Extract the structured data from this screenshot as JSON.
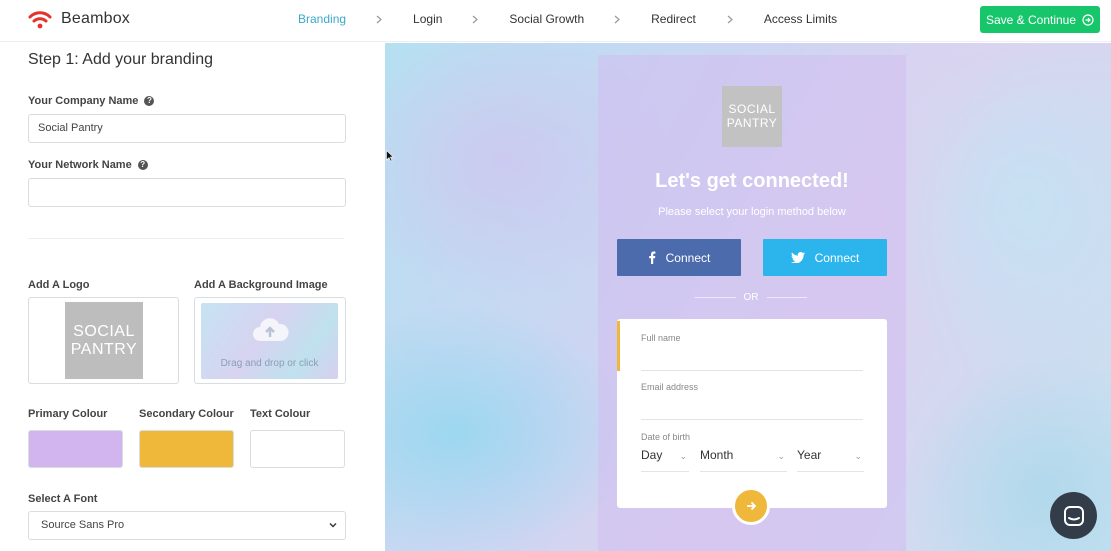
{
  "app": {
    "name": "Beambox",
    "brand_color": "#e5322d",
    "icon": "wifi-icon"
  },
  "nav": {
    "steps": [
      {
        "label": "Branding",
        "active": true
      },
      {
        "label": "Login",
        "active": false
      },
      {
        "label": "Social Growth",
        "active": false
      },
      {
        "label": "Redirect",
        "active": false
      },
      {
        "label": "Access Limits",
        "active": false
      }
    ],
    "save_label": "Save & Continue",
    "save_color": "#17c66b"
  },
  "form": {
    "heading": "Step 1: Add your branding",
    "company_label": "Your Company Name",
    "company_value": "Social Pantry",
    "network_label": "Your Network Name",
    "network_value": "",
    "logo_label": "Add A Logo",
    "logo_text_1": "SOCIAL",
    "logo_text_2": "PANTRY",
    "bg_label": "Add A Background Image",
    "bg_hint": "Drag and drop or click",
    "primary_label": "Primary Colour",
    "primary_color": "#d2b5ef",
    "secondary_label": "Secondary Colour",
    "secondary_color": "#f0b83a",
    "text_label": "Text Colour",
    "text_color": "#ffffff",
    "font_label": "Select A Font",
    "font_value": "Source Sans Pro"
  },
  "preview": {
    "logo_text_1": "SOCIAL",
    "logo_text_2": "PANTRY",
    "title": "Let's get connected!",
    "subtitle": "Please select your login method below",
    "facebook_label": "Connect",
    "twitter_label": "Connect",
    "or_label": "OR",
    "fullname_label": "Full name",
    "email_label": "Email address",
    "dob_label": "Date of birth",
    "day_label": "Day",
    "month_label": "Month",
    "year_label": "Year"
  }
}
